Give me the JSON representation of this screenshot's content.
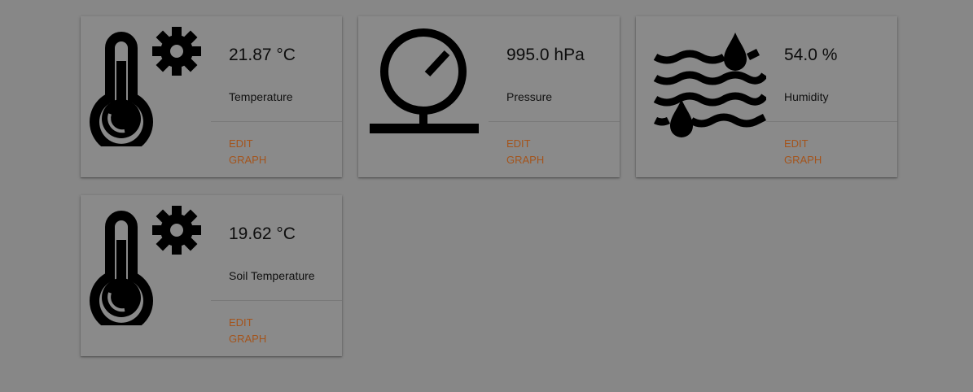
{
  "cards": [
    {
      "icon": "thermometer-gear-icon",
      "value": "21.87 °C",
      "label": "Temperature",
      "edit": "EDIT",
      "graph": "GRAPH"
    },
    {
      "icon": "pressure-gauge-icon",
      "value": "995.0 hPa",
      "label": "Pressure",
      "edit": "EDIT",
      "graph": "GRAPH"
    },
    {
      "icon": "humidity-waves-drops-icon",
      "value": "54.0 %",
      "label": "Humidity",
      "edit": "EDIT",
      "graph": "GRAPH"
    },
    {
      "icon": "thermometer-gear-icon",
      "value": "19.62 °C",
      "label": "Soil Temperature",
      "edit": "EDIT",
      "graph": "GRAPH"
    }
  ],
  "colors": {
    "background": "#878787",
    "card": "#8a8a8a",
    "action": "#a4541c",
    "icon": "#000000"
  }
}
